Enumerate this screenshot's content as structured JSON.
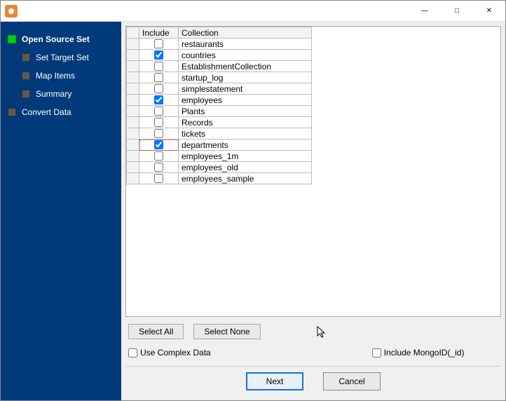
{
  "sidebar": {
    "steps": [
      {
        "label": "Open Source Set",
        "active": true,
        "sub": false
      },
      {
        "label": "Set Target Set",
        "active": false,
        "sub": true
      },
      {
        "label": "Map Items",
        "active": false,
        "sub": true
      },
      {
        "label": "Summary",
        "active": false,
        "sub": true
      },
      {
        "label": "Convert Data",
        "active": false,
        "sub": false
      }
    ]
  },
  "table": {
    "headers": {
      "include": "Include",
      "collection": "Collection"
    },
    "rows": [
      {
        "include": false,
        "name": "restaurants",
        "highlight": false
      },
      {
        "include": true,
        "name": "countries",
        "highlight": false
      },
      {
        "include": false,
        "name": "EstablishmentCollection",
        "highlight": false
      },
      {
        "include": false,
        "name": "startup_log",
        "highlight": false
      },
      {
        "include": false,
        "name": "simplestatement",
        "highlight": false
      },
      {
        "include": true,
        "name": "employees",
        "highlight": false
      },
      {
        "include": false,
        "name": "Plants",
        "highlight": false
      },
      {
        "include": false,
        "name": "Records",
        "highlight": false
      },
      {
        "include": false,
        "name": "tickets",
        "highlight": false
      },
      {
        "include": true,
        "name": "departments",
        "highlight": true
      },
      {
        "include": false,
        "name": "employees_1m",
        "highlight": false
      },
      {
        "include": false,
        "name": "employees_old",
        "highlight": false
      },
      {
        "include": false,
        "name": "employees_sample",
        "highlight": false
      }
    ]
  },
  "buttons": {
    "select_all": "Select All",
    "select_none": "Select None",
    "next": "Next",
    "cancel": "Cancel"
  },
  "options": {
    "use_complex_data": {
      "label": "Use Complex Data",
      "checked": false
    },
    "include_mongo_id": {
      "label": "Include MongoID(_id)",
      "checked": false
    }
  }
}
